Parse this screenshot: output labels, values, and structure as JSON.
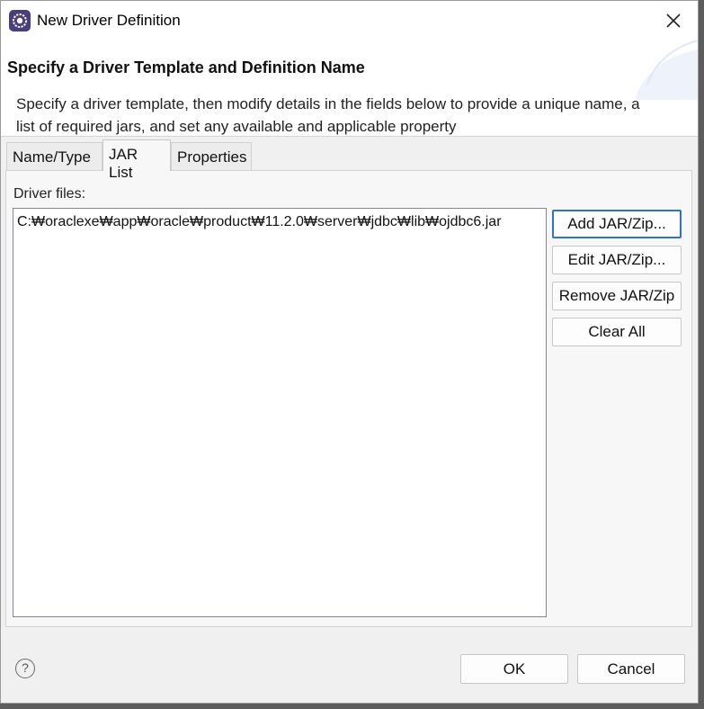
{
  "window": {
    "title": "New Driver Definition"
  },
  "header": {
    "title": "Specify a Driver Template and Definition Name",
    "description": "Specify a driver template, then modify details in the fields below to provide a unique name, a list of required jars, and set any available and applicable property"
  },
  "tabs": [
    {
      "label": "Name/Type",
      "active": false
    },
    {
      "label": "JAR List",
      "active": true
    },
    {
      "label": "Properties",
      "active": false
    }
  ],
  "panel": {
    "driver_files_label": "Driver files:",
    "files": [
      "C:₩oraclexe₩app₩oracle₩product₩11.2.0₩server₩jdbc₩lib₩ojdbc6.jar"
    ]
  },
  "side_buttons": {
    "add": "Add JAR/Zip...",
    "edit": "Edit JAR/Zip...",
    "remove": "Remove JAR/Zip",
    "clear": "Clear All"
  },
  "footer": {
    "help_icon": "question-mark",
    "ok": "OK",
    "cancel": "Cancel"
  },
  "colors": {
    "accent": "#2f6fd6",
    "dialog_background": "#f0f0f0",
    "header_background": "#ffffff"
  },
  "icons": {
    "app": "eclipse-gear-icon",
    "close": "close-icon"
  }
}
